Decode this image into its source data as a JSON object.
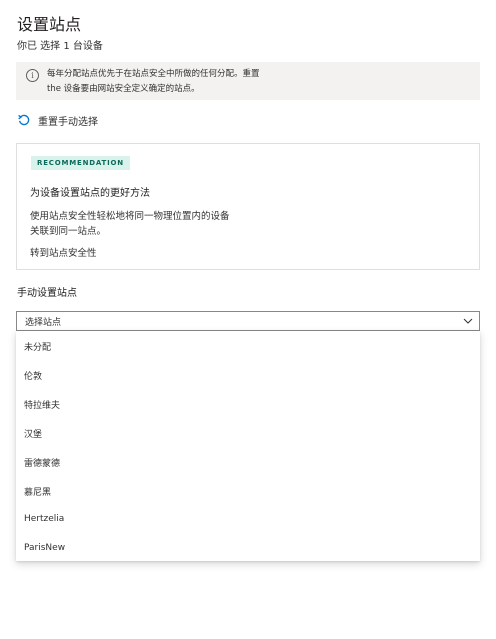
{
  "header": {
    "title": "设置站点",
    "subtitle": "你已 选择 1 台设备"
  },
  "info_bar": {
    "icon": "info-icon",
    "line1": "每年分配站点优先于在站点安全中所做的任何分配。重置",
    "line2": "the 设备要由网站安全定义确定的站点。"
  },
  "reset": {
    "icon": "undo-icon",
    "label": "重置手动选择"
  },
  "recommendation": {
    "badge": "RECOMMENDATION",
    "heading": "为设备设置站点的更好方法",
    "body_line1": "使用站点安全性轻松地将同一物理位置内的设备",
    "body_line2": "关联到同一站点。",
    "link": "转到站点安全性"
  },
  "manual": {
    "label": "手动设置站点"
  },
  "select": {
    "value": "选择站点",
    "icon": "chevron-down-icon",
    "options": [
      "未分配",
      "伦敦",
      "特拉维夫",
      "汉堡",
      "雷德蒙德",
      "慕尼黑",
      "Hertzelia",
      "ParisNew"
    ]
  },
  "colors": {
    "badge_bg": "#d9f2ec",
    "badge_text": "#0b6a5a",
    "accent_blue": "#0078d4",
    "info_bg": "#f3f2f1"
  }
}
